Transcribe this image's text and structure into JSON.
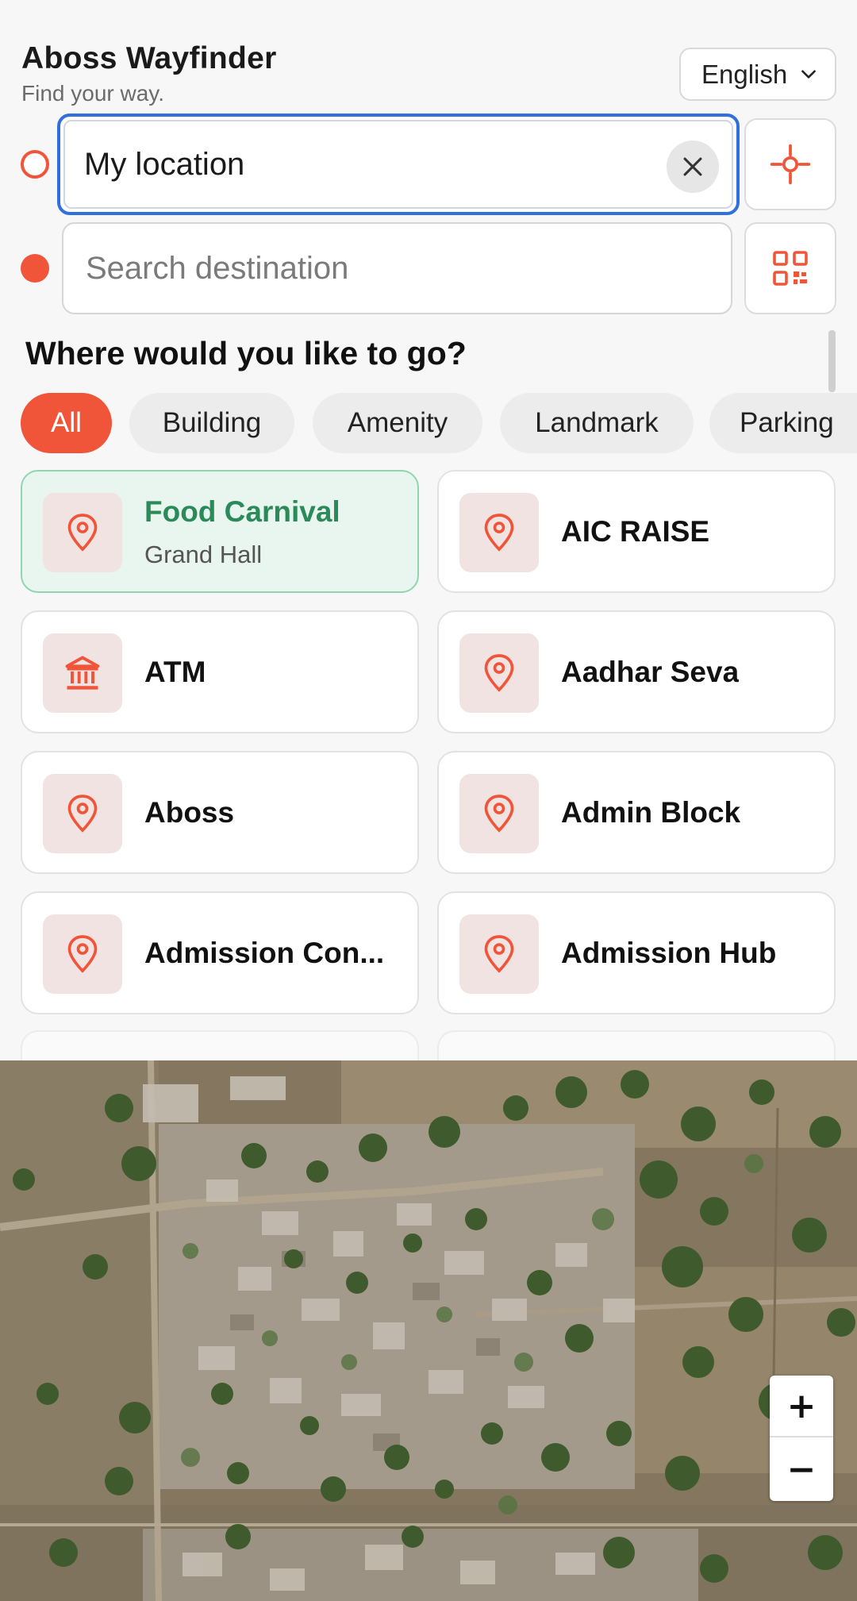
{
  "header": {
    "title": "Aboss Wayfinder",
    "subtitle": "Find your way."
  },
  "language": {
    "selected": "English"
  },
  "route": {
    "origin_value": "My location",
    "destination_placeholder": "Search destination"
  },
  "section_title": "Where would you like to go?",
  "categories": [
    "All",
    "Building",
    "Amenity",
    "Landmark",
    "Parking"
  ],
  "active_category": "All",
  "places": [
    {
      "name": "Food Carnival",
      "subtitle": "Grand Hall",
      "icon": "map-pin-icon",
      "selected": true
    },
    {
      "name": "AIC RAISE",
      "icon": "map-pin-icon"
    },
    {
      "name": "ATM",
      "icon": "bank-icon"
    },
    {
      "name": "Aadhar Seva",
      "icon": "map-pin-icon"
    },
    {
      "name": "Aboss",
      "icon": "map-pin-icon"
    },
    {
      "name": "Admin Block",
      "icon": "map-pin-icon"
    },
    {
      "name": "Admission Con...",
      "icon": "map-pin-icon"
    },
    {
      "name": "Admission Hub",
      "icon": "map-pin-icon"
    }
  ],
  "map": {
    "zoom_in": "+",
    "zoom_out": "−"
  },
  "colors": {
    "accent": "#f0553a",
    "focus_blue": "#2f6fde",
    "selected_green": "#2a8a5a",
    "selected_bg": "#e9f6ef"
  }
}
